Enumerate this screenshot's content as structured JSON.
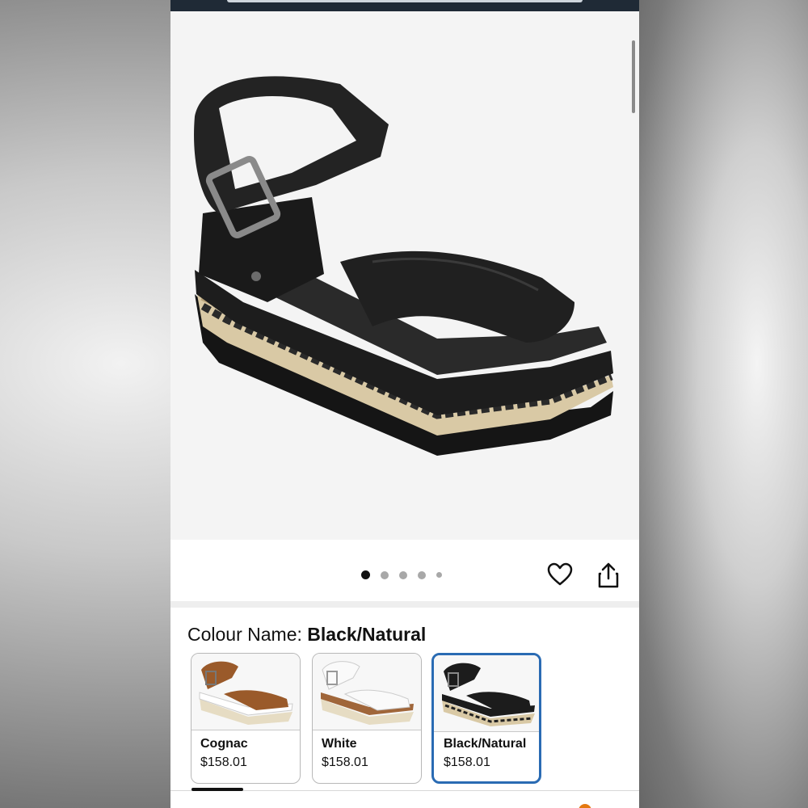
{
  "product": {
    "image_alt": "Black leather ankle-strap platform sandal with braided espadrille sole",
    "carousel_dots": 5,
    "carousel_active_index": 0
  },
  "colour": {
    "label": "Colour Name: ",
    "selected": "Black/Natural"
  },
  "swatches": [
    {
      "name": "Cognac",
      "price": "$158.01",
      "color": "#9a5a2a"
    },
    {
      "name": "White",
      "price": "$158.01",
      "color": "#f2f2f2"
    },
    {
      "name": "Black/Natural",
      "price": "$158.01",
      "color": "#1c1c1c"
    }
  ],
  "icons": {
    "wishlist": "heart-icon",
    "share": "share-icon"
  },
  "colors": {
    "selected_border": "#2a6bb3",
    "header_bg": "#1f2a36",
    "cart_badge": "#e47911"
  }
}
